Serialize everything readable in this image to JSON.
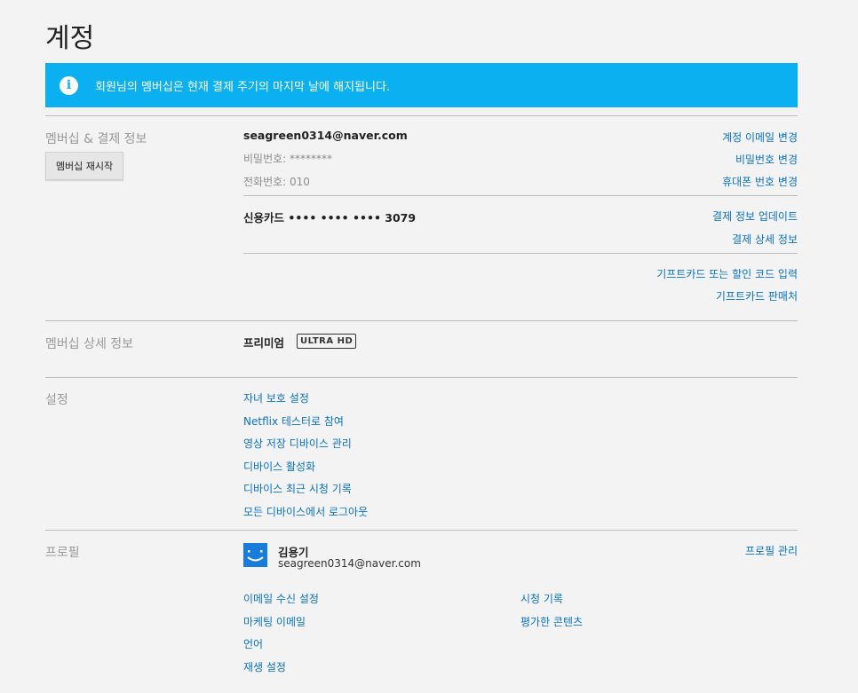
{
  "page": {
    "title": "계정"
  },
  "banner": {
    "icon": "info-icon",
    "text": "회원님의 멤버십은 현재 결제 주기의 마지막 날에 해지됩니다."
  },
  "membership": {
    "section_label": "멤버십 & 결제 정보",
    "restart_button": "멤버십 재시작",
    "email": "seagreen0314@naver.com",
    "password": "비밀번호: ********",
    "phone": "전화번호: 010",
    "change_email": "계정 이메일 변경",
    "change_password": "비밀번호 변경",
    "change_phone": "휴대폰 번호 변경",
    "card": "신용카드 •••• •••• •••• 3079",
    "update_payment": "결제 정보 업데이트",
    "billing_details": "결제 상세 정보",
    "redeem_gift": "기프트카드 또는 할인 코드 입력",
    "gift_retailers": "기프트카드 판매처"
  },
  "plan": {
    "section_label": "멤버십 상세 정보",
    "name": "프리미엄",
    "badge": "ULTRA HD"
  },
  "settings": {
    "section_label": "설정",
    "items": [
      "자녀 보호 설정",
      "Netflix 테스터로 참여",
      "영상 저장 디바이스 관리",
      "디바이스 활성화",
      "디바이스 최근 시청 기록",
      "모든 디바이스에서 로그아웃"
    ]
  },
  "profile": {
    "section_label": "프로필",
    "name": "김용기",
    "email": "seagreen0314@naver.com",
    "manage": "프로필 관리",
    "left_links": [
      "이메일 수신 설정",
      "마케팅 이메일",
      "언어",
      "재생 설정"
    ],
    "right_links": [
      "시청 기록",
      "평가한 콘텐츠"
    ]
  },
  "colors": {
    "accent": "#0ab0ef",
    "link": "#0a72c6",
    "background": "#f3f3f3"
  }
}
